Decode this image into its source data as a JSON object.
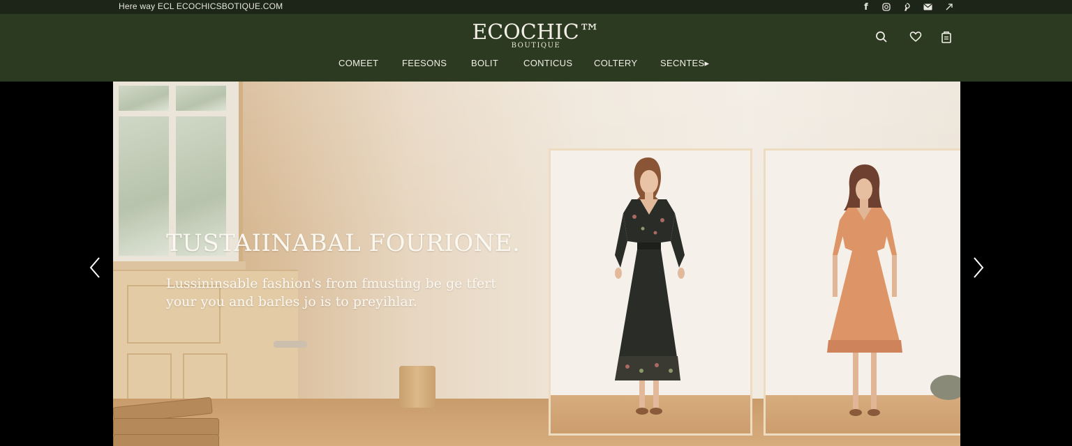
{
  "topbar": {
    "text": "Here way ECL ECOCHICSBOTIQUE.COM",
    "social_icons": [
      "facebook-icon",
      "instagram-icon",
      "pinterest-icon",
      "mail-icon",
      "share-icon"
    ],
    "facebook_glyph": "f"
  },
  "header": {
    "logo": "ECOCHIC™",
    "logo_sub": "BOUTIQUE",
    "icons": [
      "search-icon",
      "heart-icon",
      "bag-icon"
    ]
  },
  "nav": {
    "items": [
      {
        "label": "COMEET"
      },
      {
        "label": "FEESONS"
      },
      {
        "label": "BOLIT"
      },
      {
        "label": "CONTICUS"
      },
      {
        "label": "COLTERY"
      },
      {
        "label": "SECNTES▸"
      }
    ]
  },
  "hero": {
    "title": "TUSTAIINABAL FOURIONE.",
    "subtitle": "Lussininsable fashion's from fmusting be ge tfert your you and barles jo is to preyihlar.",
    "prev_icon": "chevron-left-icon",
    "next_icon": "chevron-right-icon"
  },
  "colors": {
    "topbar_bg": "#1d2518",
    "header_bg": "#2c3a22",
    "text_light": "#f2efe6",
    "dress_dark": "#2a2c28",
    "dress_terracotta": "#dd9466"
  }
}
